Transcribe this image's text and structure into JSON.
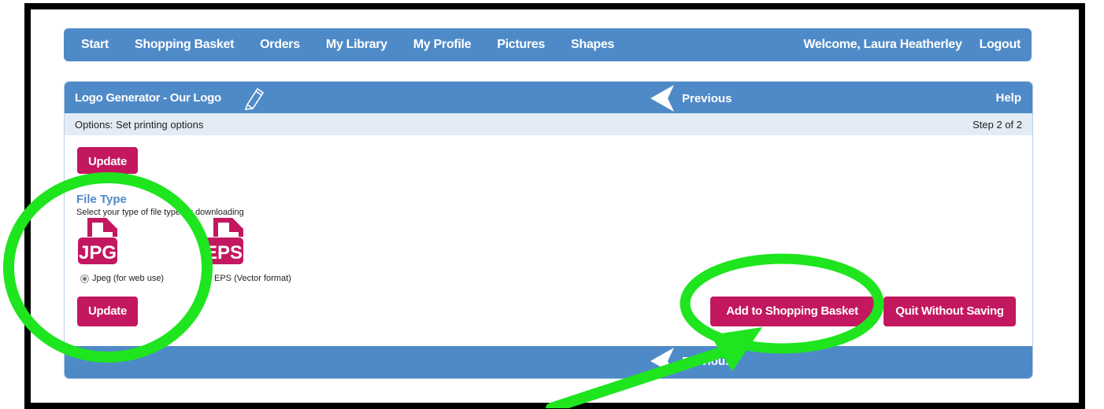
{
  "nav": {
    "items": [
      "Start",
      "Shopping Basket",
      "Orders",
      "My Library",
      "My Profile",
      "Pictures",
      "Shapes"
    ],
    "welcome": "Welcome, Laura Heatherley",
    "logout": "Logout"
  },
  "panel": {
    "title": "Logo Generator - Our Logo",
    "previous": "Previous",
    "help": "Help",
    "options": "Options: Set printing options",
    "step": "Step 2 of 2",
    "update_top": "Update",
    "file_type_title": "File Type",
    "file_type_desc": "Select your type of file type for downloading",
    "jpg_icon_text": "JPG",
    "eps_icon_text": "EPS",
    "jpeg_option": "Jpeg (for web use)",
    "eps_option": "EPS (Vector format)",
    "update_bottom": "Update",
    "add_to_basket": "Add to Shopping Basket",
    "quit": "Quit Without Saving",
    "footer_previous": "Previous"
  },
  "colors": {
    "nav_blue": "#4f8ac8",
    "button_magenta": "#c3175f",
    "annotation_green": "#1ee51e"
  }
}
